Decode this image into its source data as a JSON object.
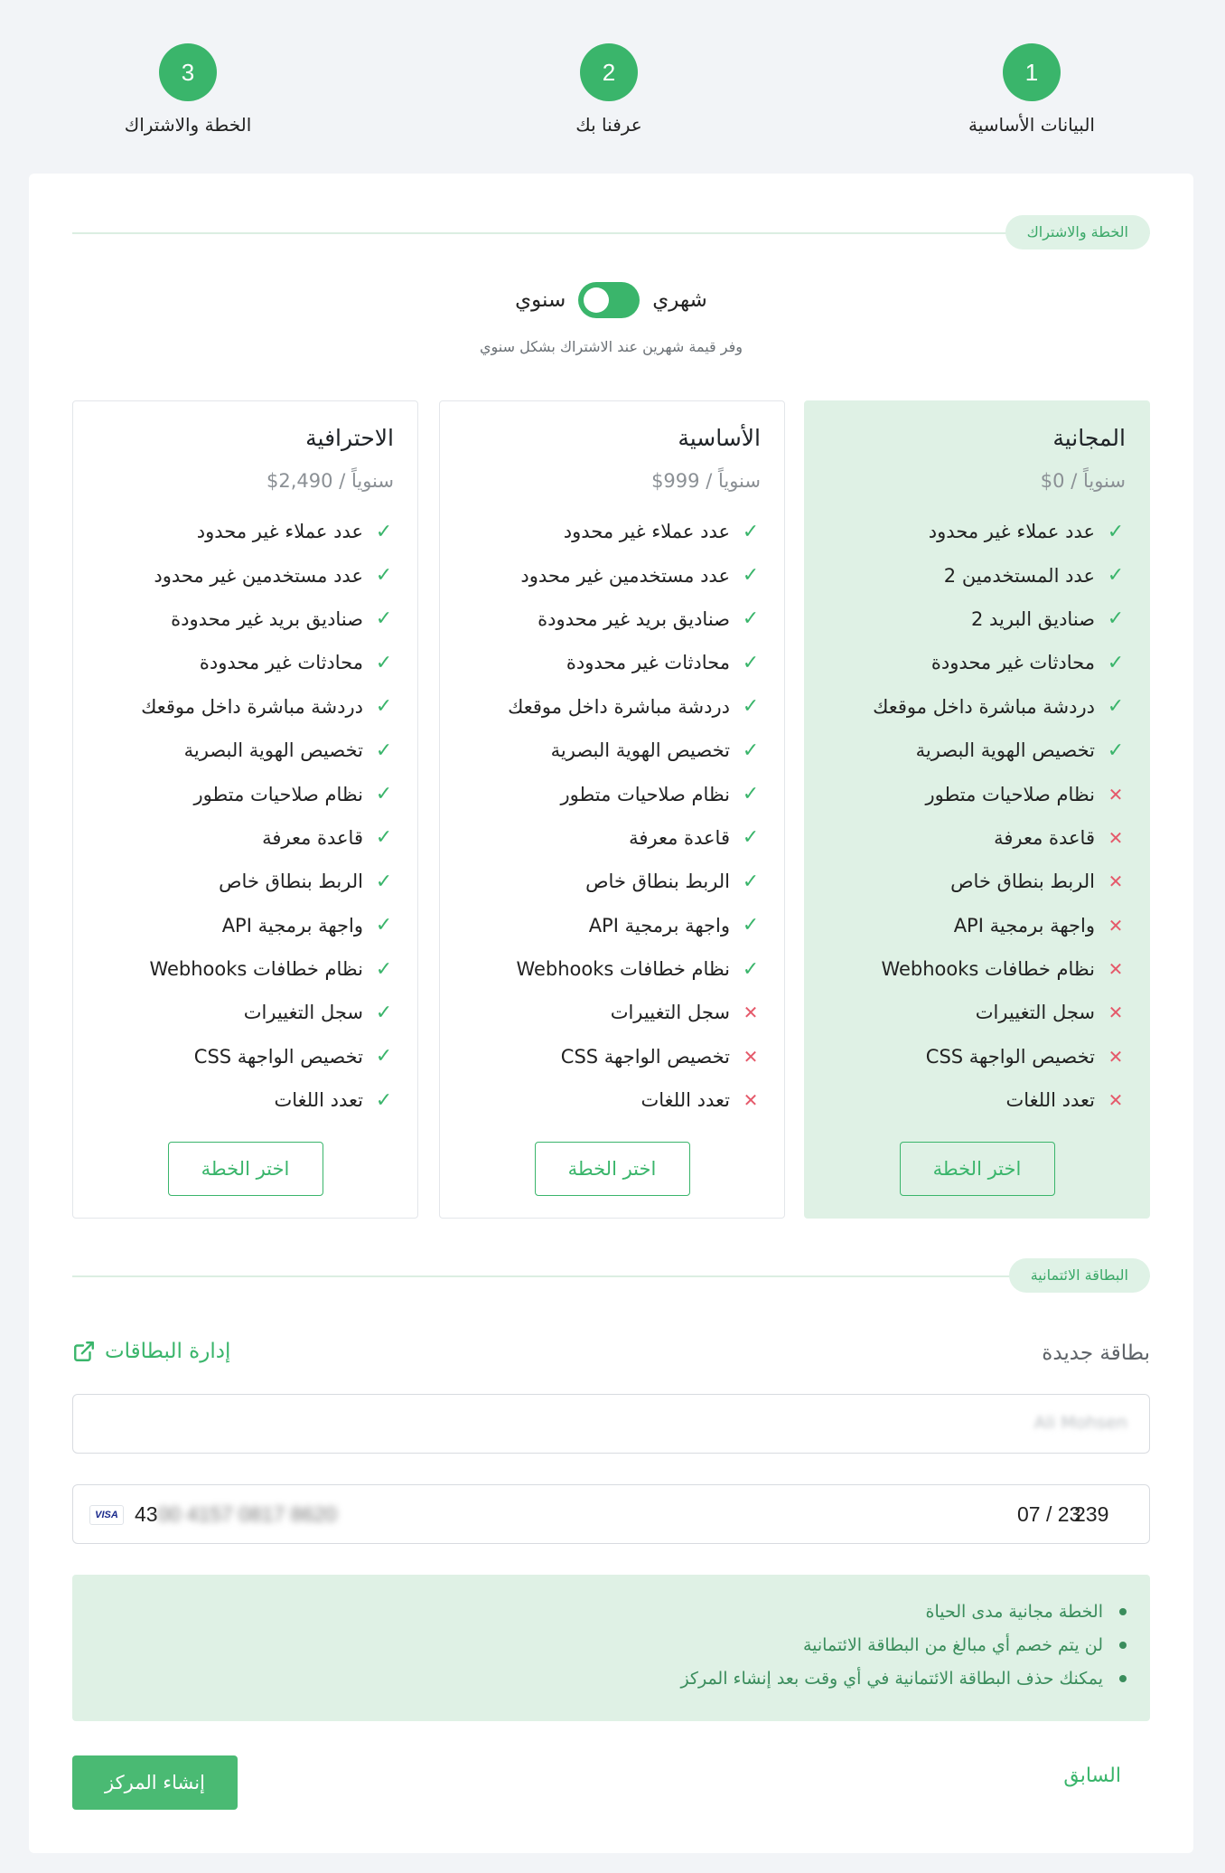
{
  "steps": [
    {
      "number": "1",
      "label": "البيانات الأساسية"
    },
    {
      "number": "2",
      "label": "عرفنا بك"
    },
    {
      "number": "3",
      "label": "الخطة والاشتراك"
    }
  ],
  "plans_section": {
    "title": "الخطة والاشتراك",
    "toggle_monthly": "شهري",
    "toggle_yearly": "سنوي",
    "toggle_state": "yearly",
    "note": "وفر قيمة شهرين عند الاشتراك بشكل سنوي"
  },
  "plans": [
    {
      "name": "المجانية",
      "price": "$0",
      "period": "/ سنوياً",
      "featured": true,
      "button": "اختر الخطة",
      "features": [
        {
          "text": "عدد عملاء غير محدود",
          "included": true
        },
        {
          "text": "عدد المستخدمين 2",
          "included": true
        },
        {
          "text": "صناديق البريد 2",
          "included": true
        },
        {
          "text": "محادثات غير محدودة",
          "included": true
        },
        {
          "text": "دردشة مباشرة داخل موقعك",
          "included": true
        },
        {
          "text": "تخصيص الهوية البصرية",
          "included": true
        },
        {
          "text": "نظام صلاحيات متطور",
          "included": false
        },
        {
          "text": "قاعدة معرفة",
          "included": false
        },
        {
          "text": "الربط بنطاق خاص",
          "included": false
        },
        {
          "text": "واجهة برمجية API",
          "included": false
        },
        {
          "text": "نظام خطافات Webhooks",
          "included": false
        },
        {
          "text": "سجل التغييرات",
          "included": false
        },
        {
          "text": "تخصيص الواجهة CSS",
          "included": false
        },
        {
          "text": "تعدد اللغات",
          "included": false
        }
      ]
    },
    {
      "name": "الأساسية",
      "price": "$999",
      "period": "/ سنوياً",
      "featured": false,
      "button": "اختر الخطة",
      "features": [
        {
          "text": "عدد عملاء غير محدود",
          "included": true
        },
        {
          "text": "عدد مستخدمين غير محدود",
          "included": true
        },
        {
          "text": "صناديق بريد غير محدودة",
          "included": true
        },
        {
          "text": "محادثات غير محدودة",
          "included": true
        },
        {
          "text": "دردشة مباشرة داخل موقعك",
          "included": true
        },
        {
          "text": "تخصيص الهوية البصرية",
          "included": true
        },
        {
          "text": "نظام صلاحيات متطور",
          "included": true
        },
        {
          "text": "قاعدة معرفة",
          "included": true
        },
        {
          "text": "الربط بنطاق خاص",
          "included": true
        },
        {
          "text": "واجهة برمجية API",
          "included": true
        },
        {
          "text": "نظام خطافات Webhooks",
          "included": true
        },
        {
          "text": "سجل التغييرات",
          "included": false
        },
        {
          "text": "تخصيص الواجهة CSS",
          "included": false
        },
        {
          "text": "تعدد اللغات",
          "included": false
        }
      ]
    },
    {
      "name": "الاحترافية",
      "price": "$2,490",
      "period": "/ سنوياً",
      "featured": false,
      "button": "اختر الخطة",
      "features": [
        {
          "text": "عدد عملاء غير محدود",
          "included": true
        },
        {
          "text": "عدد مستخدمين غير محدود",
          "included": true
        },
        {
          "text": "صناديق بريد غير محدودة",
          "included": true
        },
        {
          "text": "محادثات غير محدودة",
          "included": true
        },
        {
          "text": "دردشة مباشرة داخل موقعك",
          "included": true
        },
        {
          "text": "تخصيص الهوية البصرية",
          "included": true
        },
        {
          "text": "نظام صلاحيات متطور",
          "included": true
        },
        {
          "text": "قاعدة معرفة",
          "included": true
        },
        {
          "text": "الربط بنطاق خاص",
          "included": true
        },
        {
          "text": "واجهة برمجية API",
          "included": true
        },
        {
          "text": "نظام خطافات Webhooks",
          "included": true
        },
        {
          "text": "سجل التغييرات",
          "included": true
        },
        {
          "text": "تخصيص الواجهة CSS",
          "included": true
        },
        {
          "text": "تعدد اللغات",
          "included": true
        }
      ]
    }
  ],
  "credit_card": {
    "section_title": "البطاقة الائتمانية",
    "new_card_label": "بطاقة جديدة",
    "manage_link": "إدارة البطاقات",
    "cardholder_name": "Ali Mohsen",
    "brand": "VISA",
    "number_visible": "43",
    "number_masked": "00 4157 0817 8620",
    "expiry": "07 / 23",
    "cvc": "239"
  },
  "notes": [
    "الخطة مجانية مدى الحياة",
    "لن يتم خصم أي مبالغ من البطاقة الائتمانية",
    "يمكنك حذف البطاقة الائتمانية في أي وقت بعد إنشاء المركز"
  ],
  "actions": {
    "previous": "السابق",
    "create": "إنشاء المركز"
  },
  "colors": {
    "accent": "#3ab56b",
    "featured_bg": "#dff1e5",
    "cross": "#e5596a"
  }
}
